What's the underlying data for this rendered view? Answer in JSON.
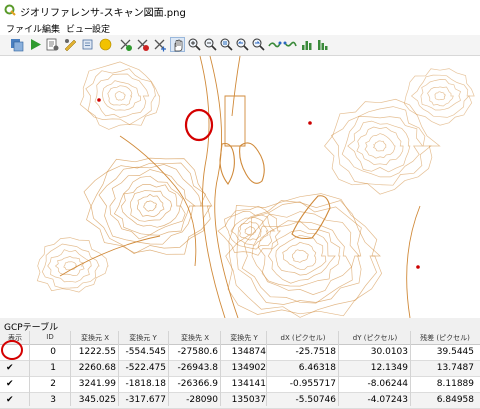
{
  "window": {
    "title": "ジオリファレンサ-スキャン図面.png"
  },
  "menu": {
    "items": [
      "ファイル",
      "編集",
      "ビュー",
      "設定"
    ]
  },
  "toolbar": {
    "icons": [
      "add-raster-icon",
      "start-georef-icon",
      "generate-script-icon",
      "transform-settings-icon",
      "load-points-icon",
      "add-point-icon",
      "delete-point-icon",
      "move-point-icon",
      "pan-icon",
      "zoom-in-icon",
      "zoom-out-icon",
      "zoom-layer-icon",
      "zoom-last-icon",
      "zoom-next-icon",
      "link-georef-icon",
      "link-qgis-icon",
      "histogram-icon",
      "full-histogram-icon"
    ],
    "active": "pan-icon"
  },
  "map": {
    "line_color": "#d08a3a",
    "point_color": "#cc0000",
    "annotation_color": "#d40000"
  },
  "gcp": {
    "title": "GCPテーブル",
    "headers": [
      "表示",
      "ID",
      "変換元 X",
      "変換元 Y",
      "変換先 X",
      "変換先 Y",
      "dX (ピクセル)",
      "dY (ピクセル)",
      "残差 (ピクセル)"
    ],
    "rows": [
      {
        "checked": false,
        "id": "0",
        "src_x": "1222.55",
        "src_y": "-554.545",
        "dst_x": "-27580.6",
        "dst_y": "134874",
        "dx": "-25.7518",
        "dy": "30.0103",
        "res": "39.5445"
      },
      {
        "checked": true,
        "id": "1",
        "src_x": "2260.68",
        "src_y": "-522.475",
        "dst_x": "-26943.8",
        "dst_y": "134902",
        "dx": "6.46318",
        "dy": "12.1349",
        "res": "13.7487"
      },
      {
        "checked": true,
        "id": "2",
        "src_x": "3241.99",
        "src_y": "-1818.18",
        "dst_x": "-26366.9",
        "dst_y": "134141",
        "dx": "-0.955717",
        "dy": "-8.06244",
        "res": "8.11889"
      },
      {
        "checked": true,
        "id": "3",
        "src_x": "345.025",
        "src_y": "-317.677",
        "dst_x": "-28090",
        "dst_y": "135037",
        "dx": "-5.50746",
        "dy": "-4.07243",
        "res": "6.84958"
      }
    ]
  }
}
